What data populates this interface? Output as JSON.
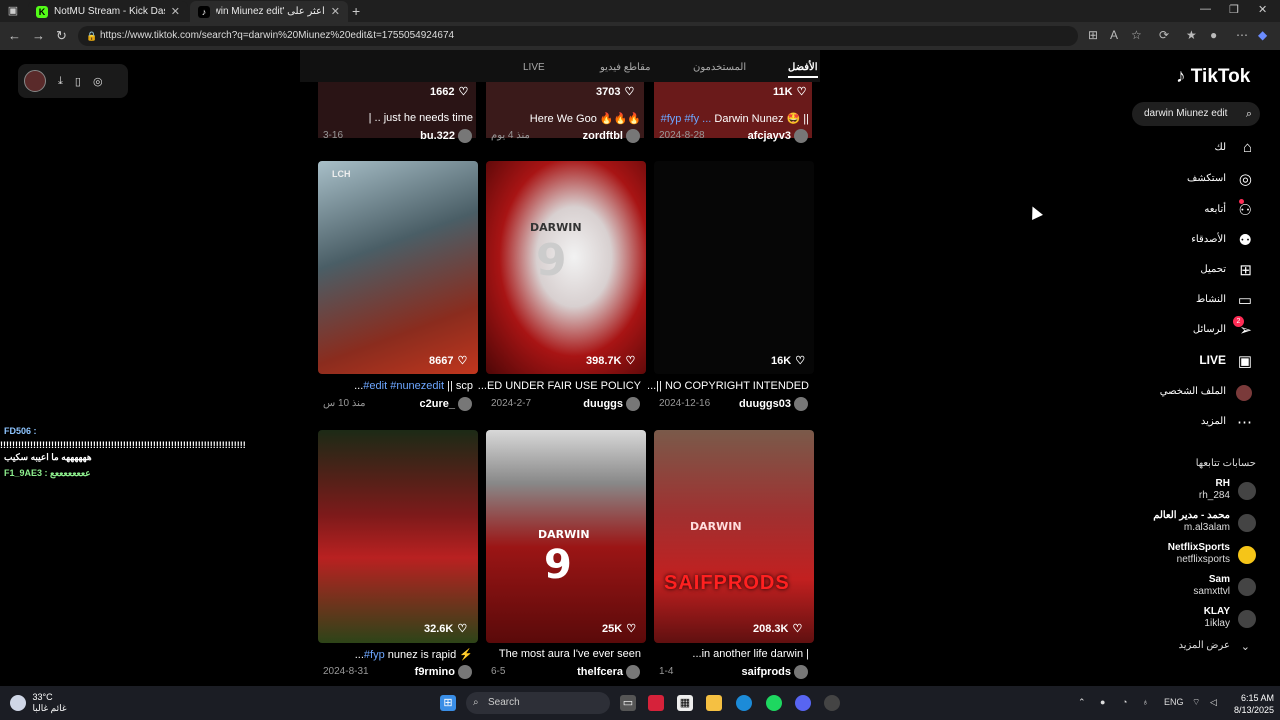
{
  "browser": {
    "tabs": [
      {
        "title": "NotMU Stream - Kick Dashboard",
        "favicon": "K"
      },
      {
        "title": "اعثر على 'darwin Miunez edit' علـ",
        "favicon": "♪"
      }
    ],
    "url": "https://www.tiktok.com/search?q=darwin%20Miunez%20edit&t=1755054924674"
  },
  "tiktok": {
    "logo": "TikTok",
    "search_value": "darwin Miunez edit",
    "search_tabs": [
      "الأفضل",
      "المستخدمون",
      "مقاطع فيديو",
      "LIVE"
    ],
    "nav": [
      {
        "label": "لك",
        "icon": "home-icon"
      },
      {
        "label": "استكشف",
        "icon": "compass-icon"
      },
      {
        "label": "أتابعه",
        "icon": "user-plus-icon"
      },
      {
        "label": "الأصدقاء",
        "icon": "friends-icon"
      },
      {
        "label": "تحميل",
        "icon": "upload-icon"
      },
      {
        "label": "النشاط",
        "icon": "activity-icon"
      },
      {
        "label": "الرسائل",
        "icon": "messages-icon",
        "badge": "2"
      },
      {
        "label": "LIVE",
        "icon": "live-icon"
      },
      {
        "label": "الملف الشخصي",
        "icon": "avatar-icon"
      },
      {
        "label": "المزيد",
        "icon": "more-icon"
      }
    ],
    "following_title": "حسابات تتابعها",
    "following": [
      {
        "name": "RH",
        "handle": "rh_284"
      },
      {
        "name": "محمد - مدير العالم",
        "handle": "m.al3alam"
      },
      {
        "name": "NetflixSports",
        "handle": "netflixsports"
      },
      {
        "name": "Sam",
        "handle": "samxttvl"
      },
      {
        "name": "KLAY",
        "handle": "1iklay"
      }
    ],
    "see_more": "عرض المزيد",
    "top_row": [
      {
        "count": "1662",
        "caption": "just he needs time .. |",
        "author": "bu.322",
        "date": "3-16"
      },
      {
        "count": "3703",
        "caption": "Here We Goo 🔥🔥🔥",
        "author": "zordftbl",
        "date": "منذ 4 يوم"
      },
      {
        "count": "11K",
        "caption_plain": "Darwin Nunez 🤩 || ",
        "caption_tag": "#fyp #fy ...",
        "author": "afcjayv3",
        "date": "2024-8-28"
      }
    ],
    "videos": [
      {
        "count": "8667",
        "caption_plain": "scp || ",
        "caption_tag": "#edit #nunezedit",
        "caption_end": " ...",
        "author": "c2ure_",
        "date": "منذ 10 س",
        "overlay": "LCH"
      },
      {
        "count": "398.7K",
        "caption": "ED UNDER FAIR USE POLICY...",
        "author": "duuggs",
        "date": "2024-2-7",
        "jersey_name": "DARWIN",
        "jersey_number": "9"
      },
      {
        "count": "16K",
        "caption": "NO COPYRIGHT INTENDED ||...",
        "author": "duuggs03",
        "date": "2024-12-16"
      },
      {
        "count": "32.6K",
        "caption_plain": "nunez is rapid ⚡ ",
        "caption_tag": "#fyp",
        "caption_end": " ...",
        "author": "f9rmino",
        "date": "2024-8-31"
      },
      {
        "count": "25K",
        "caption": "The most aura I've ever seen",
        "author": "thelfcera",
        "date": "6-5",
        "jersey_name": "DARWIN",
        "jersey_number": "9"
      },
      {
        "count": "208.3K",
        "caption": "| in another life darwin...",
        "author": "saifprods",
        "date": "1-4",
        "jersey_name": "DARWIN",
        "watermark": "SAIFPRODS"
      }
    ]
  },
  "overlay_chat": {
    "user": "FD506 :",
    "line_a": "!!!!!!!!!!!!!!!!!!!!!!!!!!!!!!!!!!!!!!!!!!!!!!!!!!!!!!!!!!!!!!!!!!!!!!!!!!!!!!!!!!",
    "line_b": "ههههههه ما اعيبه سكيب",
    "line_c": "F1_9AE3 : ععععععععع"
  },
  "taskbar": {
    "temp": "33°C",
    "weather_text": "غائم غالبا",
    "search_placeholder": "Search",
    "lang": "ENG",
    "time": "6:15 AM",
    "date": "8/13/2025"
  },
  "colors": {
    "accent": "#fe2c55",
    "hashtag": "#6da6ff"
  }
}
